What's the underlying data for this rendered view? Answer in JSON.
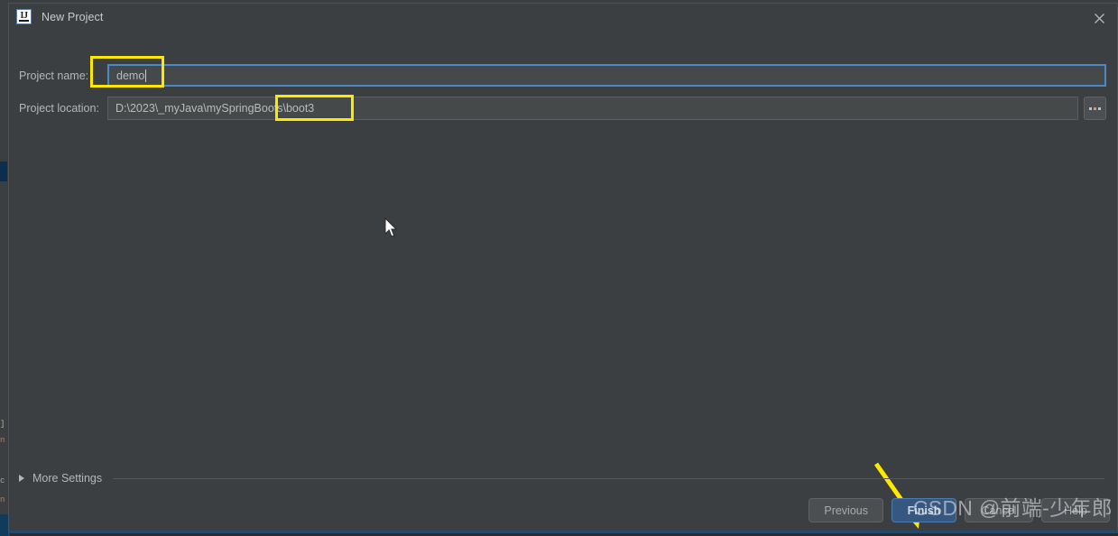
{
  "window": {
    "title": "New Project",
    "app_icon": "intellij-idea-icon",
    "icon_text": "IJ",
    "close_icon": "close-icon"
  },
  "form": {
    "fields": [
      {
        "label": "Project name:",
        "value": "demo",
        "focused": true,
        "name": "project-name"
      },
      {
        "label": "Project location:",
        "value": "D:\\2023\\_myJava\\mySpringBoots\\boot3",
        "focused": false,
        "name": "project-location"
      }
    ],
    "browse_button": {
      "label": "...",
      "icon": "ellipsis-icon"
    }
  },
  "more_settings": {
    "label": "More Settings",
    "expanded": false,
    "caret_icon": "chevron-right-icon"
  },
  "buttons": {
    "previous": "Previous",
    "finish": "Finish",
    "cancel": "Cancel",
    "help": "Help"
  },
  "annotations": {
    "highlight_boxes": [
      {
        "target": "project-name-input",
        "color": "#ffe800"
      },
      {
        "target": "project-location-path-segment",
        "color": "#ffe800"
      }
    ],
    "arrow": {
      "points_to": "finish-button",
      "color": "#ffe800"
    }
  },
  "watermark": {
    "text": "CSDN @前端-少年郎"
  },
  "colors": {
    "dialog_background": "#3c3f41",
    "ide_background": "#2b2b2b",
    "input_background": "#45494a",
    "focus_border": "#4a88c7",
    "primary_button": "#365880",
    "primary_button_border": "#4b7bb0",
    "text": "#b4b7ba",
    "annotation": "#ffe800",
    "bottom_accent": "#214a6e"
  }
}
